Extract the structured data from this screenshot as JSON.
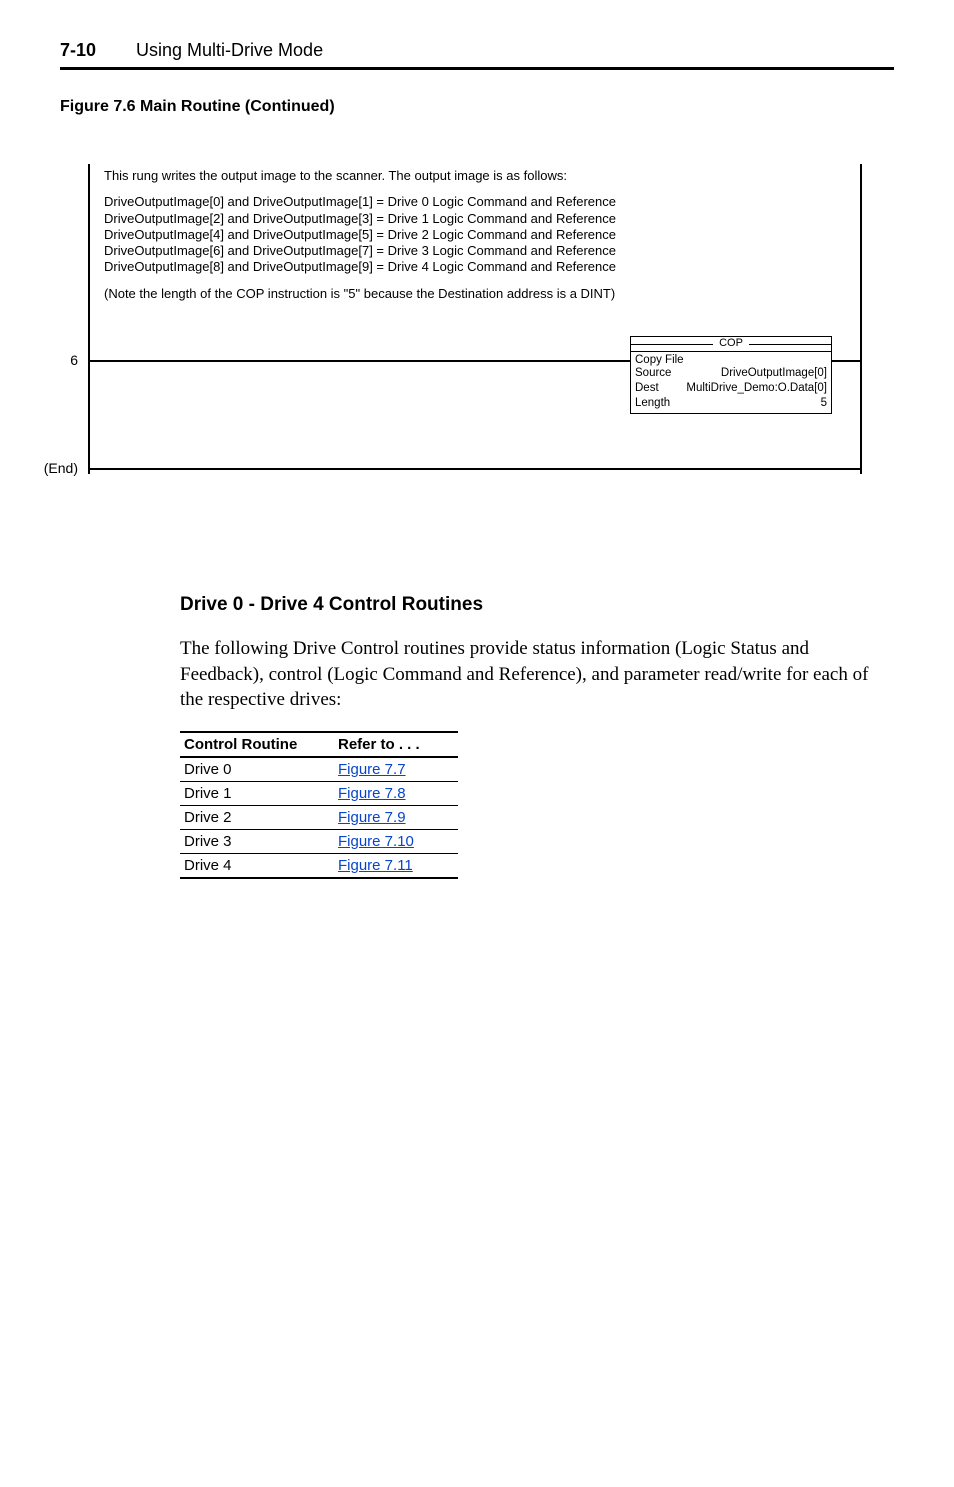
{
  "header": {
    "page_number": "7-10",
    "title": "Using Multi-Drive Mode"
  },
  "figure_caption": "Figure 7.6   Main Routine (Continued)",
  "diagram": {
    "rung_label_6": "6",
    "rung_label_end": "(End)",
    "intro_line": "This rung writes the output image to the scanner.   The output image is as follows:",
    "map_lines": [
      "DriveOutputImage[0] and DriveOutputImage[1] = Drive 0 Logic Command and Reference",
      "DriveOutputImage[2] and DriveOutputImage[3] = Drive 1 Logic Command and Reference",
      "DriveOutputImage[4] and DriveOutputImage[5] = Drive 2 Logic Command and Reference",
      "DriveOutputImage[6] and DriveOutputImage[7] = Drive 3 Logic Command and Reference",
      "DriveOutputImage[8] and DriveOutputImage[9] = Drive 4 Logic Command and Reference"
    ],
    "note_line": "(Note the length of the COP instruction is \"5\" because the Destination address is a DINT)",
    "cop": {
      "header": "COP",
      "title": "Copy File",
      "source_label": "Source",
      "source_value": "DriveOutputImage[0]",
      "dest_label": "Dest",
      "dest_value": "MultiDrive_Demo:O.Data[0]",
      "length_label": "Length",
      "length_value": "5"
    }
  },
  "section": {
    "heading": "Drive 0 - Drive 4 Control Routines",
    "paragraph": "The following Drive Control routines provide status information (Logic Status and Feedback), control (Logic Command and Reference), and parameter read/write for each of the respective drives:"
  },
  "ref_table": {
    "head_routine": "Control Routine",
    "head_refer": "Refer to . . .",
    "rows": [
      {
        "routine": "Drive 0",
        "ref": "Figure 7.7"
      },
      {
        "routine": "Drive 1",
        "ref": "Figure 7.8"
      },
      {
        "routine": "Drive 2",
        "ref": "Figure 7.9"
      },
      {
        "routine": "Drive 3",
        "ref": "Figure 7.10"
      },
      {
        "routine": "Drive 4",
        "ref": "Figure 7.11"
      }
    ]
  }
}
